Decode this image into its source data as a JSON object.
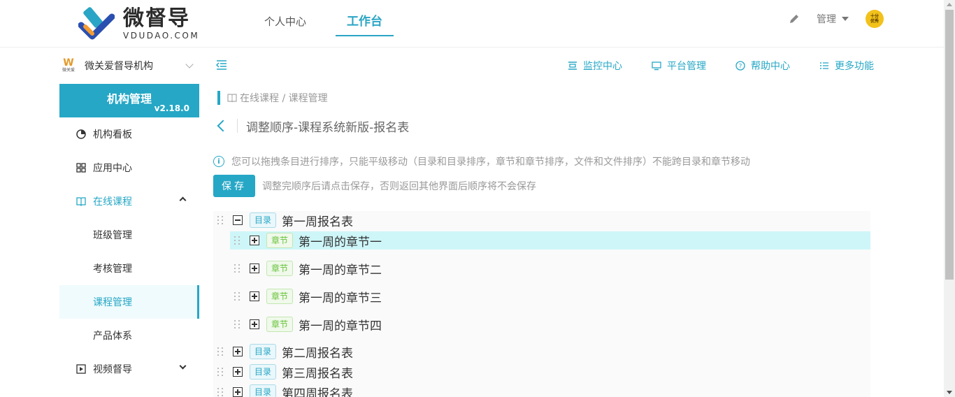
{
  "header": {
    "logo_cn": "微督导",
    "logo_en": "VDUDAO.COM",
    "nav": [
      {
        "label": "个人中心",
        "active": false
      },
      {
        "label": "工作台",
        "active": true
      }
    ],
    "admin_label": "管理",
    "avatar_text_1": "十分",
    "avatar_text_2": "优秀"
  },
  "sidebar": {
    "org_name": "微关爱督导机构",
    "org_logo_text": "微关爱",
    "manage_title": "机构管理",
    "version": "v2.18.0",
    "items": [
      {
        "label": "机构看板"
      },
      {
        "label": "应用中心"
      },
      {
        "label": "在线课程"
      },
      {
        "label": "班级管理"
      },
      {
        "label": "考核管理"
      },
      {
        "label": "课程管理"
      },
      {
        "label": "产品体系"
      },
      {
        "label": "视频督导"
      }
    ]
  },
  "toolbar": {
    "links": [
      {
        "label": "监控中心"
      },
      {
        "label": "平台管理"
      },
      {
        "label": "帮助中心"
      },
      {
        "label": "更多功能"
      }
    ]
  },
  "breadcrumb": "在线课程 / 课程管理",
  "page_title": "调整顺序-课程系统新版-报名表",
  "tip": "您可以拖拽条目进行排序，只能平级移动（目录和目录排序，章节和章节排序，文件和文件排序）不能跨目录和章节移动",
  "save_label": "保存",
  "save_hint": "调整完顺序后请点击保存，否则返回其他界面后顺序将不会保存",
  "tree": {
    "dir_tag": "目录",
    "chap_tag": "章节",
    "rows": [
      {
        "label": "第一周报名表"
      },
      {
        "label": "第一周的章节一"
      },
      {
        "label": "第一周的章节二"
      },
      {
        "label": "第一周的章节三"
      },
      {
        "label": "第一周的章节四"
      },
      {
        "label": "第二周报名表"
      },
      {
        "label": "第三周报名表"
      },
      {
        "label": "第四周报名表"
      }
    ]
  },
  "colors": {
    "accent": "#26a7c6",
    "highlight_row": "#cef6f8",
    "chapter_tag": "#67c23a"
  }
}
